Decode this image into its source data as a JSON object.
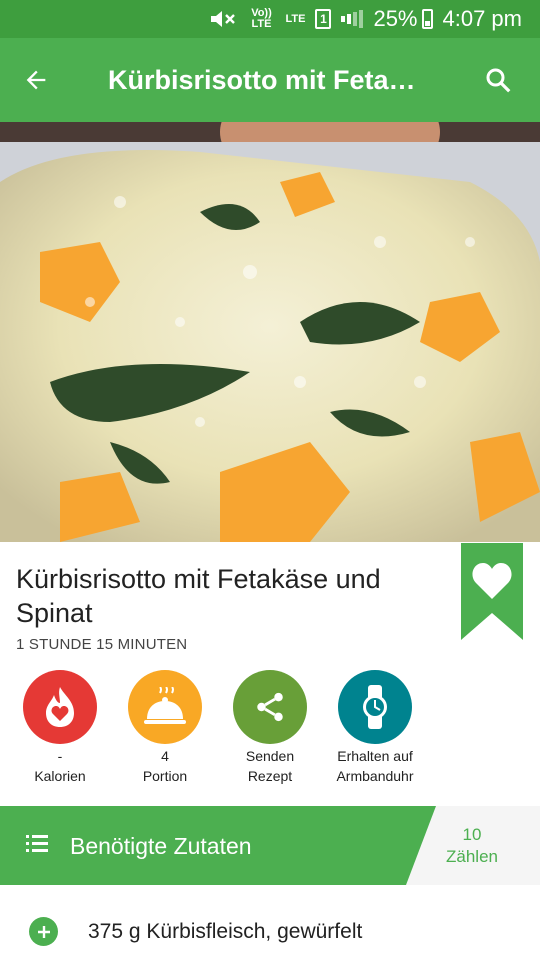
{
  "status_bar": {
    "volte_label": "Vo)) LTE",
    "lte_label": "LTE",
    "sim_label": "1",
    "battery": "25%",
    "time": "4:07 pm",
    "colors": {
      "bg": "#3e9e3e"
    }
  },
  "toolbar": {
    "title": "Kürbisrisotto mit Fetak…",
    "back_icon": "arrow-back-icon",
    "search_icon": "search-icon",
    "color": "#4caf50"
  },
  "recipe": {
    "title": "Kürbisrisotto mit Fetakäse und Spinat",
    "duration": "1 STUNDE 15 MINUTEN",
    "favorite_icon": "heart-bookmark-icon"
  },
  "actions": [
    {
      "value": "-",
      "label": "Kalorien",
      "icon": "flame-heart-icon",
      "color": "#e53935"
    },
    {
      "value": "4",
      "label": "Portion",
      "icon": "cloche-icon",
      "color": "#f9a825"
    },
    {
      "value": "Senden",
      "label": "Rezept",
      "icon": "share-icon",
      "color": "#689f38"
    },
    {
      "value": "Erhalten auf",
      "label": "Armbanduhr",
      "icon": "watch-icon",
      "color": "#00838f"
    }
  ],
  "ingredients": {
    "header": "Benötigte Zutaten",
    "count_value": "10",
    "count_label": "Zählen",
    "items": [
      {
        "text": "375 g Kürbisfleisch, gewürfelt"
      }
    ]
  }
}
